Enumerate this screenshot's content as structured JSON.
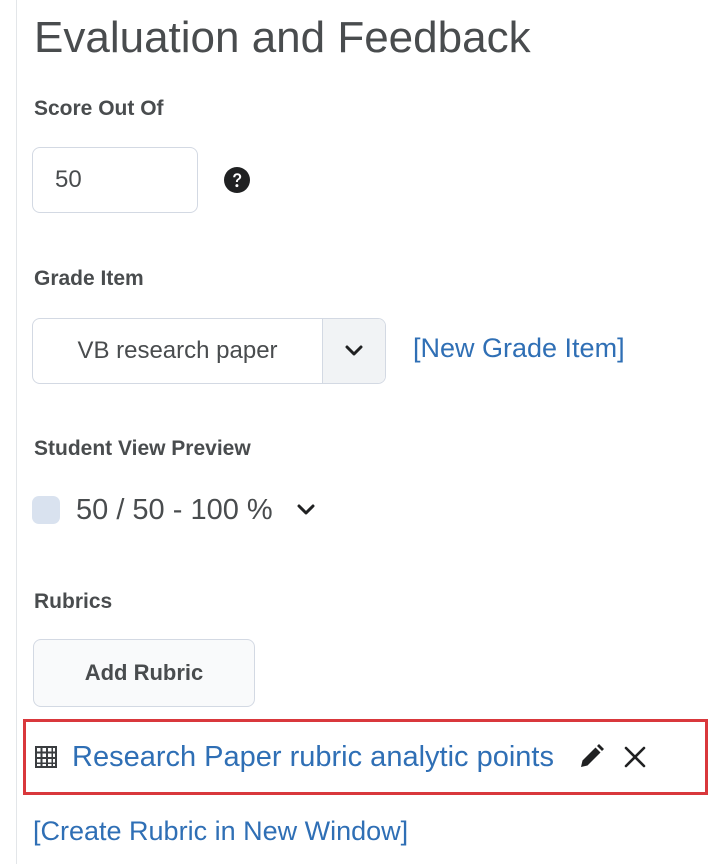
{
  "section": {
    "title": "Evaluation and Feedback"
  },
  "score": {
    "label": "Score Out Of",
    "value": "50",
    "help_icon": "question-circle-icon"
  },
  "grade_item": {
    "label": "Grade Item",
    "selected": "VB research paper",
    "new_link": "[New Grade Item]"
  },
  "student_view": {
    "label": "Student View Preview",
    "value": "50 / 50 - 100 %"
  },
  "rubrics": {
    "label": "Rubrics",
    "add_button": "Add Rubric",
    "attached": {
      "name": "Research Paper rubric analytic points",
      "icon": "rubric-grid-icon"
    },
    "create_link": "[Create Rubric in New Window]",
    "highlight_color": "#d9383c"
  },
  "colors": {
    "link": "#2f6fb5",
    "text": "#494c4e"
  }
}
